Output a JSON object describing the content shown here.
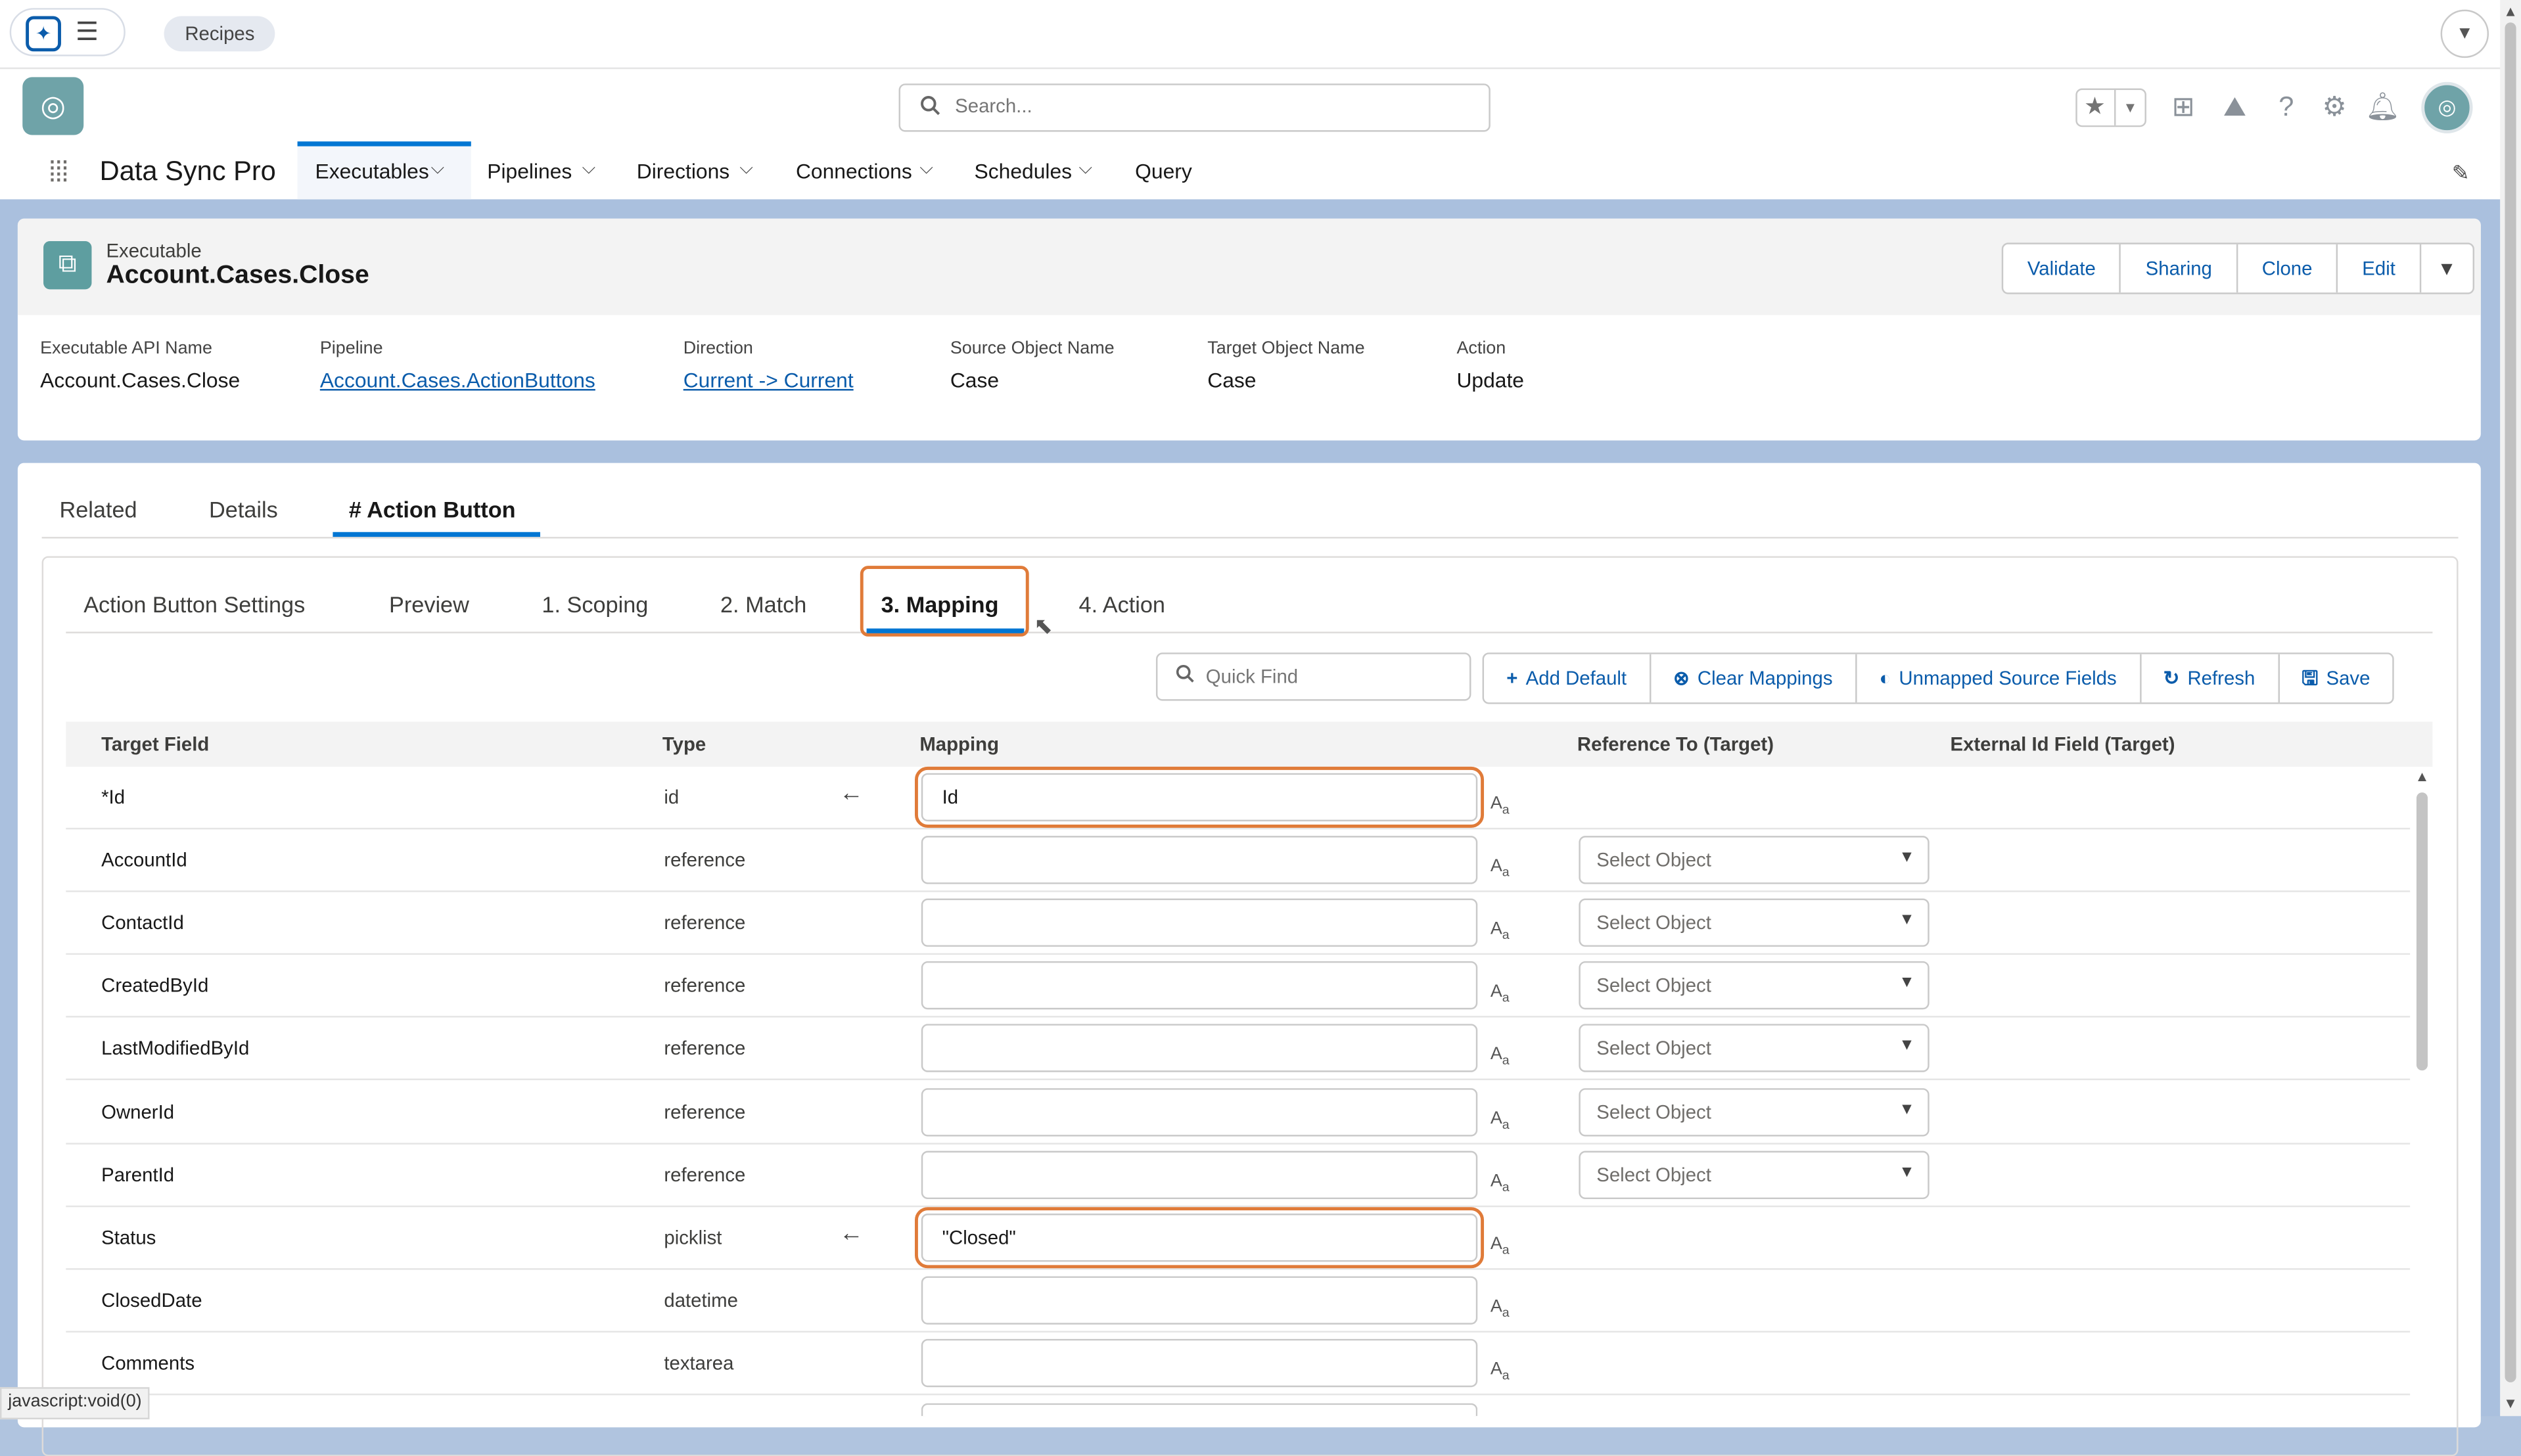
{
  "topbar": {
    "recipes_label": "Recipes"
  },
  "header": {
    "search_placeholder": "Search..."
  },
  "nav": {
    "app_name": "Data Sync Pro",
    "items": [
      {
        "label": "Executables"
      },
      {
        "label": "Pipelines"
      },
      {
        "label": "Directions"
      },
      {
        "label": "Connections"
      },
      {
        "label": "Schedules"
      },
      {
        "label": "Query"
      }
    ]
  },
  "record": {
    "type_label": "Executable",
    "title": "Account.Cases.Close",
    "actions": [
      "Validate",
      "Sharing",
      "Clone",
      "Edit"
    ],
    "fields": [
      {
        "label": "Executable API Name",
        "value": "Account.Cases.Close"
      },
      {
        "label": "Pipeline",
        "value": "Account.Cases.ActionButtons"
      },
      {
        "label": "Direction",
        "value": "Current -> Current"
      },
      {
        "label": "Source Object Name",
        "value": "Case"
      },
      {
        "label": "Target Object Name",
        "value": "Case"
      },
      {
        "label": "Action",
        "value": "Update"
      }
    ]
  },
  "tabs": [
    "Related",
    "Details",
    "# Action Button"
  ],
  "subtabs": [
    "Action Button Settings",
    "Preview",
    "1. Scoping",
    "2. Match",
    "3. Mapping",
    "4. Action"
  ],
  "toolbar": {
    "quickfind_placeholder": "Quick Find",
    "buttons": [
      "Add Default",
      "Clear Mappings",
      "Unmapped Source Fields",
      "Refresh",
      "Save"
    ]
  },
  "table": {
    "headers": [
      "Target Field",
      "Type",
      "Mapping",
      "Reference To (Target)",
      "External Id Field (Target)"
    ],
    "select_placeholder": "Select Object",
    "rows": [
      {
        "field": "*Id",
        "type": "id",
        "mapping": "Id"
      },
      {
        "field": "AccountId",
        "type": "reference",
        "mapping": ""
      },
      {
        "field": "ContactId",
        "type": "reference",
        "mapping": ""
      },
      {
        "field": "CreatedById",
        "type": "reference",
        "mapping": ""
      },
      {
        "field": "LastModifiedById",
        "type": "reference",
        "mapping": ""
      },
      {
        "field": "OwnerId",
        "type": "reference",
        "mapping": ""
      },
      {
        "field": "ParentId",
        "type": "reference",
        "mapping": ""
      },
      {
        "field": "Status",
        "type": "picklist",
        "mapping": "\"Closed\""
      },
      {
        "field": "ClosedDate",
        "type": "datetime",
        "mapping": ""
      },
      {
        "field": "Comments",
        "type": "textarea",
        "mapping": ""
      }
    ]
  },
  "status_bar": "javascript:void(0)",
  "colors": {
    "accent": "#0176d3",
    "highlight": "#e07b39",
    "link": "#0b5cab"
  }
}
